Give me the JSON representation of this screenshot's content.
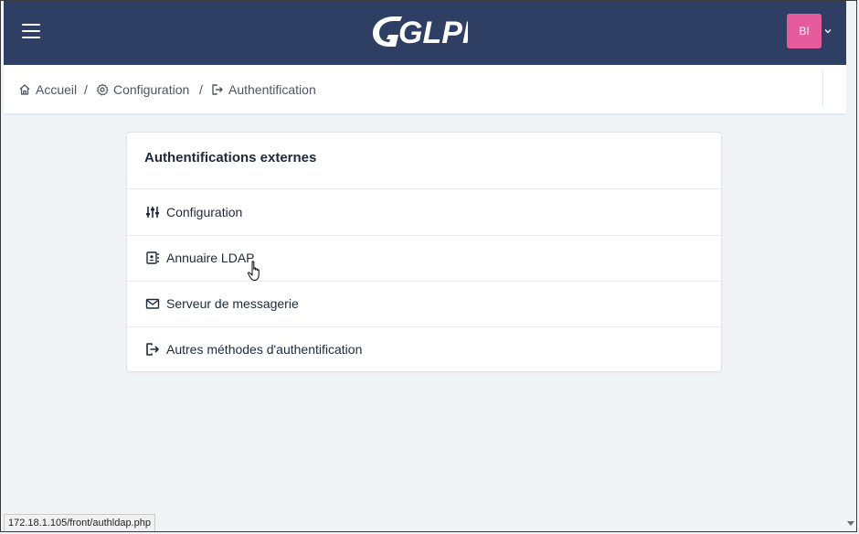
{
  "app": {
    "logo_text": "GLPI",
    "user_initials": "BI",
    "brand_color": "#2f3f64",
    "avatar_color": "#e55b9c"
  },
  "breadcrumb": [
    {
      "label": "Accueil",
      "icon": "home-icon"
    },
    {
      "label": "Configuration",
      "icon": "gear-icon"
    },
    {
      "label": "Authentification",
      "icon": "sign-in-icon"
    }
  ],
  "card": {
    "title": "Authentifications externes",
    "items": [
      {
        "label": "Configuration",
        "icon": "sliders-icon"
      },
      {
        "label": "Annuaire LDAP",
        "icon": "address-book-icon"
      },
      {
        "label": "Serveur de messagerie",
        "icon": "mail-icon"
      },
      {
        "label": "Autres méthodes d'authentification",
        "icon": "sign-in-icon"
      }
    ]
  },
  "status_bar": {
    "url": "172.18.1.105/front/authldap.php"
  }
}
